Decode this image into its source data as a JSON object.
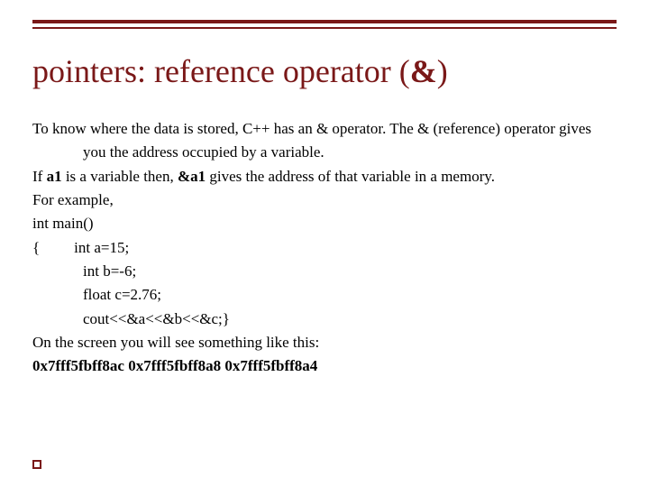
{
  "title": {
    "part1": "pointers: reference operator (",
    "amp": "&",
    "part2": ")"
  },
  "body": {
    "intro": "To know where the data is stored, C++ has an & operator. The & (reference) operator gives you the address occupied by a variable.",
    "if": {
      "pre": "If ",
      "b1": "a1",
      "mid": " is a variable then, ",
      "b2": "&a1",
      "post": " gives the address of that variable in a memory."
    },
    "example_label": "For example,",
    "code": {
      "main": "int main()",
      "brace_open": "{",
      "a": "int a=15;",
      "b": "int b=-6;",
      "c": "float c=2.76;",
      "cout": "cout<<&a<<&b<<&c;}"
    },
    "result_label": "On the screen you will see something like this:",
    "result": "0x7fff5fbff8ac 0x7fff5fbff8a8 0x7fff5fbff8a4"
  }
}
